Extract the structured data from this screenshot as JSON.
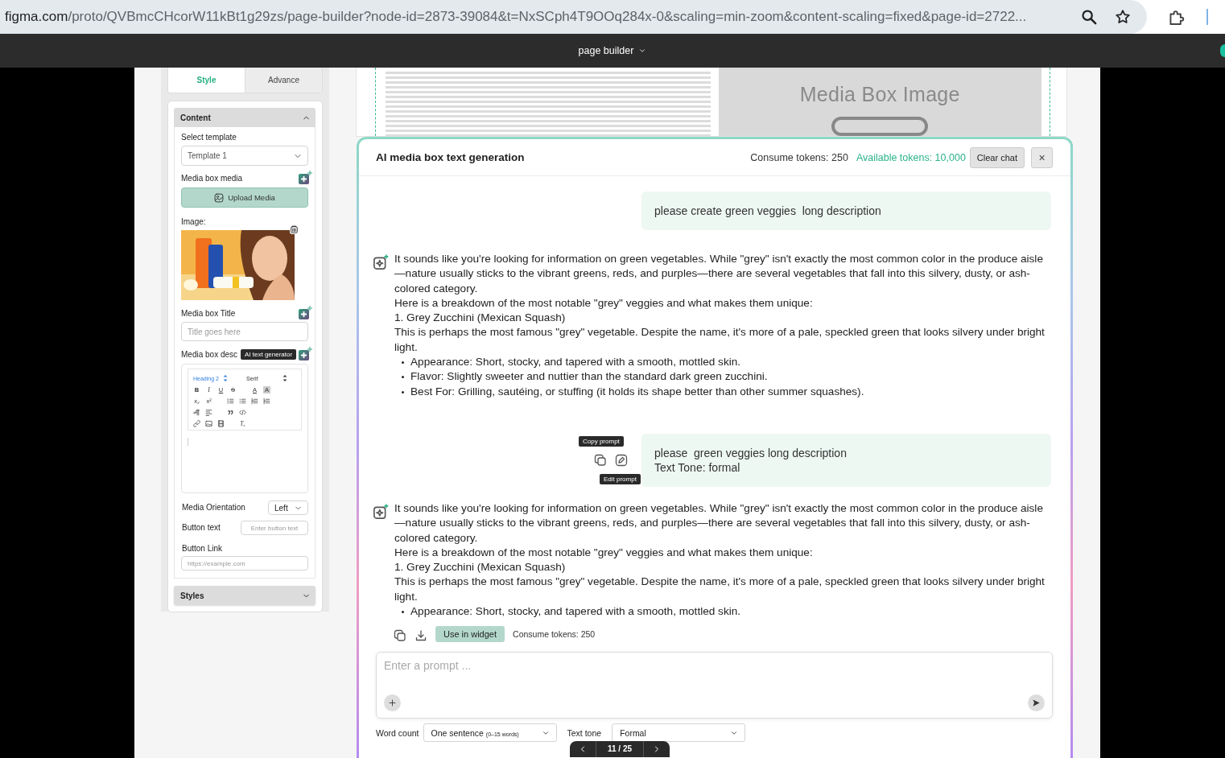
{
  "browser": {
    "host": "figma.com",
    "path": "/proto/QVBmcCHcorW11kBt1g29zs/page-builder?node-id=2873-39084&t=NxSCph4T9OOq284x-0&scaling=min-zoom&content-scaling=fixed&page-id=2722..."
  },
  "app_bar": {
    "title": "page builder"
  },
  "panel": {
    "tabs": [
      {
        "label": "Style",
        "selected": true
      },
      {
        "label": "Advance",
        "selected": false
      }
    ],
    "content": {
      "title": "Content",
      "expanded": true
    },
    "template": {
      "label": "Select template",
      "value": "Template 1"
    },
    "media": {
      "label": "Media box media",
      "button": "Upload Media"
    },
    "image": {
      "label": "Image:"
    },
    "title_field": {
      "label": "Media box Title",
      "placeholder": "Title goes here"
    },
    "description": {
      "label": "Media box desc",
      "tooltip": "AI text generator",
      "heading": "Heading 2",
      "font": "Serif",
      "glyphs": [
        "B",
        "I",
        "U",
        "S",
        "A",
        "A",
        "x₂",
        "x²",
        "Tₓ"
      ]
    },
    "orientation": {
      "label": "Media Orientation",
      "value": "Left"
    },
    "button_text": {
      "label": "Button text",
      "placeholder": "Enter button text"
    },
    "button_link": {
      "label": "Button Link",
      "placeholder": "https://example.com"
    },
    "styles": {
      "title": "Styles",
      "expanded": false
    }
  },
  "preview": {
    "image_label": "Media Box Image"
  },
  "modal": {
    "title": "AI media box text generation",
    "consume": "Consume tokens: 250",
    "available": "Available tokens: 10,000",
    "clear": "Clear chat",
    "close": "×",
    "messages": [
      {
        "kind": "user",
        "lines": [
          "please create green veggies  long description"
        ]
      },
      {
        "kind": "ai",
        "blocks": [
          {
            "kind": "p",
            "text": "It sounds like you're looking for information on green vegetables. While \"grey\" isn't exactly the most common color in the produce aisle—nature usually sticks to the vibrant greens, reds, and purples—there are several vegetables that fall into this silvery, dusty, or ash-colored category."
          },
          {
            "kind": "p",
            "text": "Here is a breakdown of the most notable \"grey\" veggies and what makes them unique:"
          },
          {
            "kind": "p",
            "text": "1. Grey Zucchini (Mexican Squash)"
          },
          {
            "kind": "p",
            "text": "This is perhaps the most famous \"grey\" vegetable. Despite the name, it's more of a pale, speckled green that looks silvery under bright light."
          },
          {
            "kind": "bullets",
            "items": [
              "Appearance: Short, stocky, and tapered with a smooth, mottled skin.",
              "Flavor: Slightly sweeter and nuttier than the standard dark green zucchini.",
              "Best For: Grilling, sautéing, or stuffing (it holds its shape better than other summer squashes)."
            ]
          }
        ]
      },
      {
        "kind": "user",
        "lines": [
          "please  green veggies long description",
          "Text Tone: formal"
        ],
        "tooltips": [
          "Copy prompt",
          "Edit prompt"
        ]
      },
      {
        "kind": "ai",
        "blocks": [
          {
            "kind": "p",
            "text": "It sounds like you're looking for information on green vegetables. While \"grey\" isn't exactly the most common color in the produce aisle—nature usually sticks to the vibrant greens, reds, and purples—there are several vegetables that fall into this silvery, dusty, or ash-colored category."
          },
          {
            "kind": "p",
            "text": "Here is a breakdown of the most notable \"grey\" veggies and what makes them unique:"
          },
          {
            "kind": "p",
            "text": "1. Grey Zucchini (Mexican Squash)"
          },
          {
            "kind": "p",
            "text": "This is perhaps the most famous \"grey\" vegetable. Despite the name, it's more of a pale, speckled green that looks silvery under bright light."
          },
          {
            "kind": "bullets",
            "items": [
              "Appearance: Short, stocky, and tapered with a smooth, mottled skin."
            ]
          }
        ],
        "actions": {
          "button": "Use in widget",
          "tokens": "Consume tokens: 250"
        }
      }
    ],
    "composer": {
      "placeholder": "Enter a prompt ..."
    },
    "options": [
      {
        "label": "Word count",
        "value": "One sentence",
        "hint": "(0–15 words)"
      },
      {
        "label": "Text tone",
        "value": "Formal"
      }
    ],
    "pager": "11 / 25"
  }
}
